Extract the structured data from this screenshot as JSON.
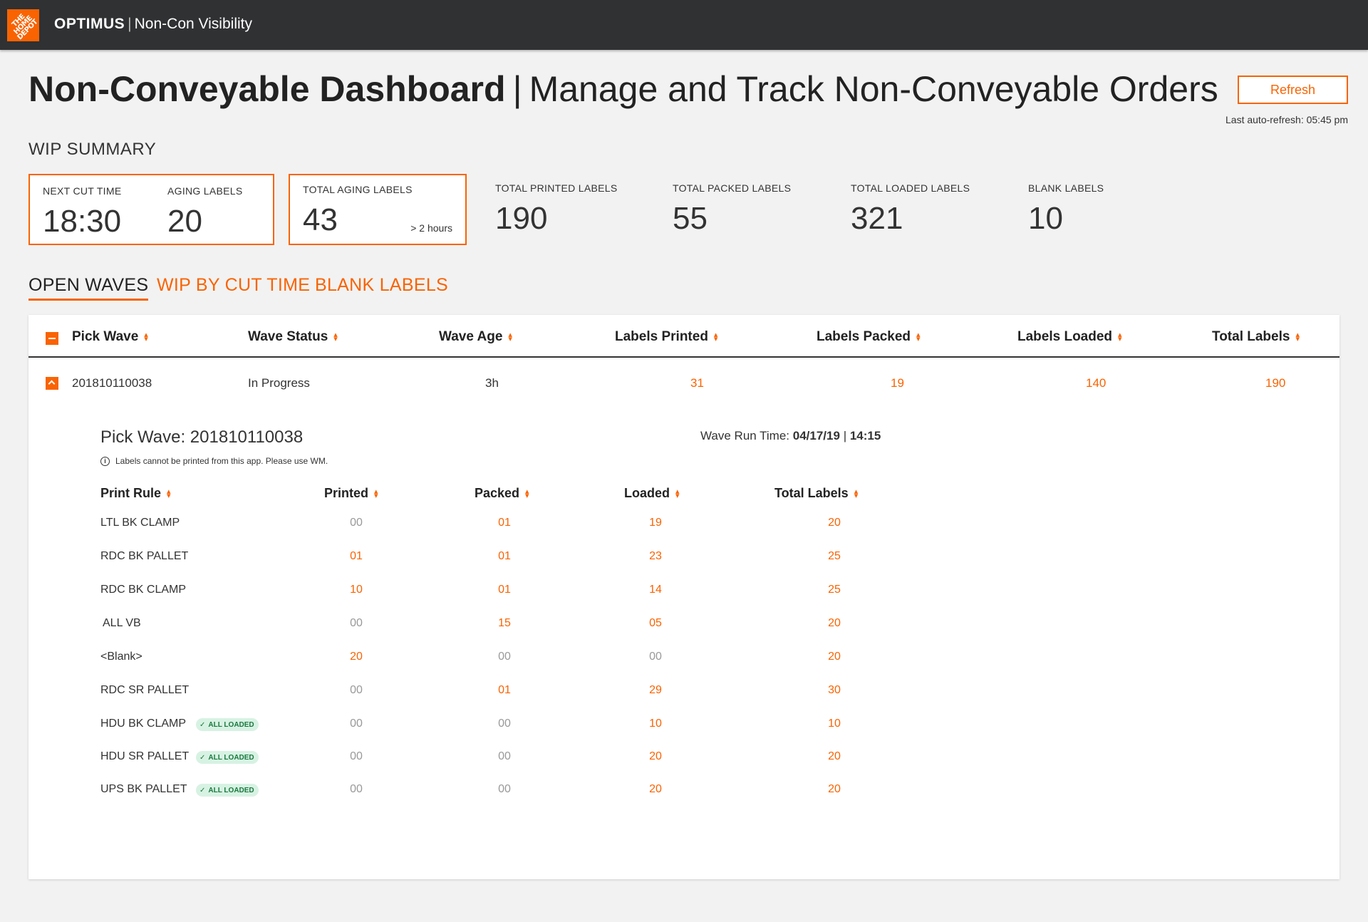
{
  "header": {
    "logo_text": "THE HOME DEPOT",
    "app_name": "OPTIMUS",
    "separator": "|",
    "app_subtitle": "Non-Con Visibility"
  },
  "page": {
    "title": "Non-Conveyable Dashboard",
    "separator": "|",
    "subtitle": "Manage and Track Non-Conveyable Orders",
    "refresh_label": "Refresh",
    "last_refresh": "Last auto-refresh: 05:45 pm"
  },
  "wip_summary": {
    "title": "WIP SUMMARY",
    "next_cut_time_label": "NEXT CUT TIME",
    "next_cut_time": "18:30",
    "aging_labels_label": "AGING LABELS",
    "aging_labels": "20",
    "total_aging_label": "TOTAL AGING LABELS",
    "total_aging": "43",
    "total_aging_note": "> 2 hours",
    "printed_label": "TOTAL PRINTED LABELS",
    "printed": "190",
    "packed_label": "TOTAL PACKED LABELS",
    "packed": "55",
    "loaded_label": "TOTAL LOADED LABELS",
    "loaded": "321",
    "blank_label": "BLANK LABELS",
    "blank": "10"
  },
  "tabs": [
    "OPEN WAVES",
    "WIP BY CUT TIME",
    "BLANK LABELS"
  ],
  "table": {
    "headers": [
      "Pick Wave",
      "Wave Status",
      "Wave Age",
      "Labels Printed",
      "Labels Packed",
      "Labels Loaded",
      "Total Labels"
    ],
    "row": {
      "pick_wave": "201810110038",
      "status": "In Progress",
      "age": "3h",
      "printed": "31",
      "packed": "19",
      "loaded": "140",
      "total": "190"
    }
  },
  "detail": {
    "title": "Pick Wave: 201810110038",
    "run_time_label": "Wave Run Time:",
    "run_date": "04/17/19",
    "run_sep": "|",
    "run_time": "14:15",
    "info_icon": "i",
    "info_text": "Labels cannot be printed from this app. Please use WM.",
    "headers": [
      "Print Rule",
      "Printed",
      "Packed",
      "Loaded",
      "Total Labels"
    ],
    "badge_label": "ALL LOADED",
    "rows": [
      {
        "rule": "LTL BK CLAMP",
        "printed": "00",
        "packed": "01",
        "loaded": "19",
        "total": "20"
      },
      {
        "rule": "RDC BK PALLET",
        "printed": "01",
        "packed": "01",
        "loaded": "23",
        "total": "25"
      },
      {
        "rule": "RDC BK CLAMP",
        "printed": "10",
        "packed": "01",
        "loaded": "14",
        "total": "25"
      },
      {
        "rule": "ALL VB",
        "printed": "00",
        "packed": "15",
        "loaded": "05",
        "total": "20"
      },
      {
        "rule": "<Blank>",
        "printed": "20",
        "packed": "00",
        "loaded": "00",
        "total": "20"
      },
      {
        "rule": "RDC SR PALLET",
        "printed": "00",
        "packed": "01",
        "loaded": "29",
        "total": "30"
      },
      {
        "rule": "HDU BK CLAMP",
        "printed": "00",
        "packed": "00",
        "loaded": "10",
        "total": "10"
      },
      {
        "rule": "HDU SR PALLET",
        "printed": "00",
        "packed": "00",
        "loaded": "20",
        "total": "20"
      },
      {
        "rule": "UPS BK PALLET",
        "printed": "00",
        "packed": "00",
        "loaded": "20",
        "total": "20"
      }
    ]
  },
  "colors": {
    "brand": "#f96302",
    "topbar": "#2f3133",
    "badge_bg": "#d7f2e3",
    "badge_text": "#1a7a3e"
  }
}
